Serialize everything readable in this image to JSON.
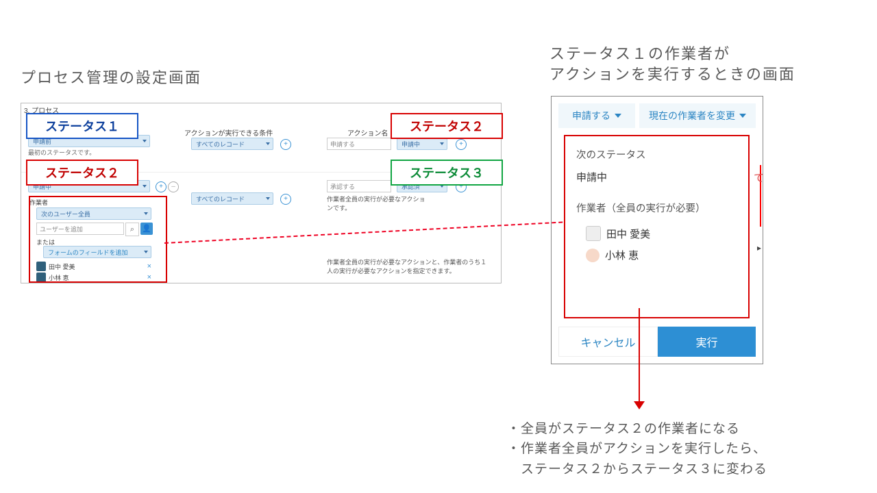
{
  "captions": {
    "left": "プロセス管理の設定画面",
    "right_l1": "ステータス１の作業者が",
    "right_l2": "アクションを実行するときの画面"
  },
  "labels": {
    "status1": "ステータス１",
    "status2": "ステータス２",
    "status3": "ステータス３"
  },
  "settings": {
    "header": "3. プロセス",
    "col_cond": "アクションが実行できる条件",
    "col_action": "アクション名（ボタン名）",
    "first_status_desc": "最初のステータスです。",
    "status_drops": {
      "first": "申請前",
      "second": "申請中"
    },
    "all_records": "すべてのレコード",
    "actions": {
      "submit": "申請する",
      "approve": "承認する"
    },
    "next": {
      "a": "申請中",
      "b": "承認済"
    },
    "workers": {
      "title": "作業者",
      "all_users": "次のユーザー全員",
      "placeholder": "ユーザーを追加",
      "or": "または",
      "form_field": "フォームのフィールドを追加",
      "u1": "田中 愛美",
      "u2": "小林 恵"
    },
    "row2_note_l1": "作業者全員の実行が必要なアクショ",
    "row2_note_l2": "ンです。",
    "foot_note": "作業者全員の実行が必要なアクションと、作業者のうち１人の実行が必要なアクションを指定できます。"
  },
  "dialog": {
    "btn_submit": "申請する",
    "btn_change": "現在の作業者を変更",
    "next_status_lbl": "次のステータス",
    "next_status_val": "申請中",
    "workers_lbl": "作業者（全員の実行が必要）",
    "u1": "田中 愛美",
    "u2": "小林 恵",
    "cancel": "キャンセル",
    "ok": "実行",
    "side": "て"
  },
  "bottom": {
    "b1": "・全員がステータス２の作業者になる",
    "b2": "・作業者全員がアクションを実行したら、",
    "b3": "　ステータス２からステータス３に変わる"
  }
}
